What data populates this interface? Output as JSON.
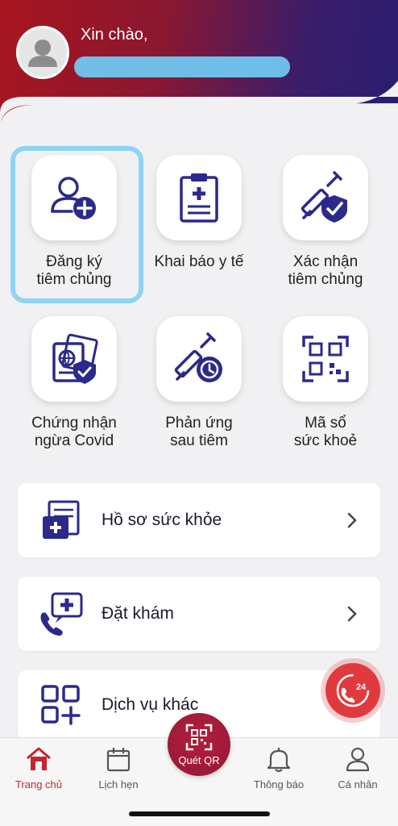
{
  "header": {
    "greeting": "Xin chào,"
  },
  "tiles": [
    {
      "label": "Đăng ký\ntiêm chủng",
      "icon": "add-user-icon"
    },
    {
      "label": "Khai báo y tế",
      "icon": "clipboard-medical-icon"
    },
    {
      "label": "Xác nhận\ntiêm chủng",
      "icon": "syringe-shield-icon"
    },
    {
      "label": "Chứng nhận\nngừa Covid",
      "icon": "passport-shield-icon"
    },
    {
      "label": "Phản ứng\nsau tiêm",
      "icon": "syringe-clock-icon"
    },
    {
      "label": "Mã sổ\nsức khoẻ",
      "icon": "qr-code-icon"
    }
  ],
  "cards": [
    {
      "label": "Hồ sơ sức khỏe",
      "icon": "health-record-icon"
    },
    {
      "label": "Đặt khám",
      "icon": "phone-medical-icon"
    },
    {
      "label": "Dịch vụ khác",
      "icon": "grid-plus-icon"
    }
  ],
  "fab": {
    "label": "24"
  },
  "bottom_nav": {
    "home": "Trang chủ",
    "schedule": "Lịch hẹn",
    "scan": "Quét QR",
    "notifications": "Thông báo",
    "profile": "Cá nhân"
  },
  "colors": {
    "primary": "#2b2a8a",
    "accent_red": "#c8242b",
    "highlight": "#8fd3f5"
  }
}
